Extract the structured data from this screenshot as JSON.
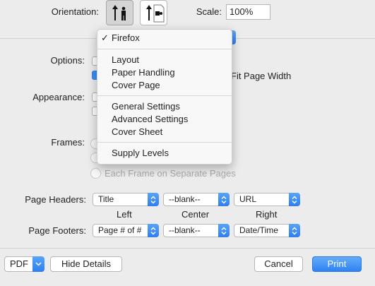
{
  "orientation": {
    "label": "Orientation:",
    "portrait_selected": true
  },
  "scale": {
    "label": "Scale:",
    "value": "100%"
  },
  "options": {
    "label": "Options:",
    "fit_width_label": "Fit Page Width"
  },
  "appearance": {
    "label": "Appearance:"
  },
  "frames": {
    "label": "Frames:",
    "each_frame_label": "Each Frame on Separate Pages"
  },
  "page_headers": {
    "label": "Page Headers:",
    "left": "Title",
    "center": "--blank--",
    "right": "URL"
  },
  "columns": {
    "left": "Left",
    "center": "Center",
    "right": "Right"
  },
  "page_footers": {
    "label": "Page Footers:",
    "left": "Page # of #",
    "center": "--blank--",
    "right": "Date/Time"
  },
  "menu": {
    "checked_item": "Firefox",
    "check_mark": "✓",
    "group1": [
      "Layout",
      "Paper Handling",
      "Cover Page"
    ],
    "group2": [
      "General Settings",
      "Advanced Settings",
      "Cover Sheet"
    ],
    "group3": [
      "Supply Levels"
    ]
  },
  "buttons": {
    "pdf": "PDF",
    "hide_details": "Hide Details",
    "cancel": "Cancel",
    "print": "Print"
  },
  "colors": {
    "accent": "#3b8ff6",
    "background": "#ececec"
  }
}
